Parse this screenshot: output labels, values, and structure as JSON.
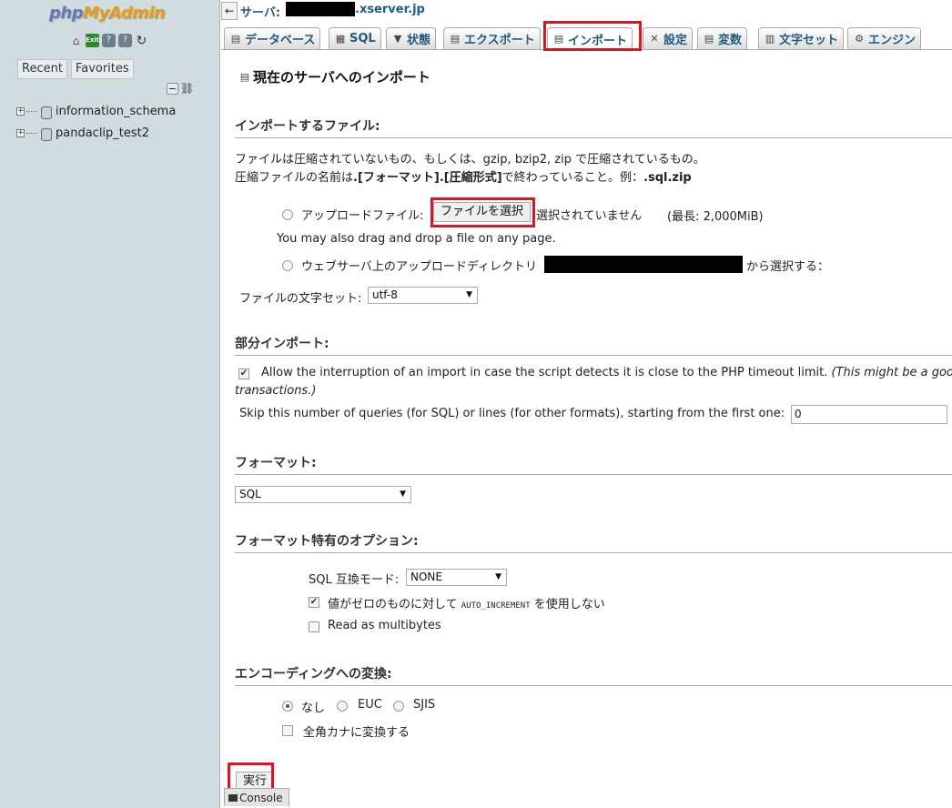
{
  "nav": {
    "logo_php": "php",
    "logo_myadmin": "MyAdmin",
    "icons": [
      "home-icon",
      "exit-icon",
      "docs-icon",
      "help-icon",
      "reload-icon"
    ],
    "tabs": [
      "Recent",
      "Favorites"
    ],
    "databases": [
      "information_schema",
      "pandaclip_test2"
    ]
  },
  "topbar": {
    "server_label": "サーバ:",
    "server_host": ".xserver.jp"
  },
  "tabs": [
    {
      "label": "データベース",
      "icon": "database-icon"
    },
    {
      "label": "SQL",
      "icon": "sql-icon"
    },
    {
      "label": "状態",
      "icon": "status-icon"
    },
    {
      "label": "エクスポート",
      "icon": "export-icon"
    },
    {
      "label": "インポート",
      "icon": "import-icon",
      "active": true
    },
    {
      "label": "設定",
      "icon": "settings-icon"
    },
    {
      "label": "変数",
      "icon": "variables-icon"
    },
    {
      "label": "文字セット",
      "icon": "charset-icon"
    },
    {
      "label": "エンジン",
      "icon": "engine-icon"
    }
  ],
  "main": {
    "title": "現在のサーバへのインポート",
    "file_section": {
      "heading": "インポートするファイル:",
      "desc1": "ファイルは圧縮されていないもの、もしくは、gzip, bzip2, zip で圧縮されているもの。",
      "desc2_prefix": "圧縮ファイルの名前は",
      "desc2_format": ".[フォーマット].[圧縮形式]",
      "desc2_suffix": "で終わっていること。例：",
      "desc2_example": ".sql.zip",
      "upload_label": "アップロードファイル:",
      "choose_file": "ファイルを選択",
      "no_file": "選択されていません",
      "max_size": "(最長: 2,000MiB)",
      "drag_drop": "You may also drag and drop a file on any page.",
      "webserver_label": "ウェブサーバ上のアップロードディレクトリ",
      "webserver_suffix": "から選択する：",
      "charset_label": "ファイルの文字セット:",
      "charset_value": "utf-8"
    },
    "partial_section": {
      "heading": "部分インポート:",
      "allow_interrupt": "Allow the interruption of an import in case the script detects it is close to the PHP timeout limit.",
      "allow_interrupt_note": "(This might be a good",
      "allow_interrupt_note2": "transactions.)",
      "allow_interrupt_checked": true,
      "skip_label": "Skip this number of queries (for SQL) or lines (for other formats), starting from the first one:",
      "skip_value": "0"
    },
    "format_section": {
      "heading": "フォーマット:",
      "format_value": "SQL"
    },
    "format_options": {
      "heading": "フォーマット特有のオプション:",
      "compat_label": "SQL 互換モード:",
      "compat_value": "NONE",
      "no_auto_inc_prefix": "値がゼロのものに対して",
      "no_auto_inc_code": "AUTO_INCREMENT",
      "no_auto_inc_suffix": "を使用しない",
      "no_auto_inc_checked": true,
      "multibytes_label": "Read as multibytes",
      "multibytes_checked": false
    },
    "encoding_section": {
      "heading": "エンコーディングへの変換:",
      "options": [
        "なし",
        "EUC",
        "SJIS"
      ],
      "selected": "なし",
      "kana_label": "全角カナに変換する"
    },
    "go_button": "実行",
    "console": "Console"
  },
  "colors": {
    "highlight": "#e0141e",
    "link": "#235a81",
    "nav_bg": "#d0dce0"
  }
}
